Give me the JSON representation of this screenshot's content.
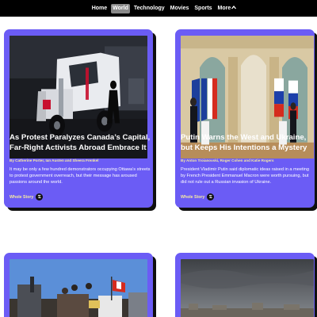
{
  "nav": {
    "items": [
      {
        "label": "Home",
        "active": false
      },
      {
        "label": "World",
        "active": true
      },
      {
        "label": "Technology",
        "active": false
      },
      {
        "label": "Movies",
        "active": false
      },
      {
        "label": "Sports",
        "active": false
      }
    ],
    "more_label": "More",
    "more_icon": "chevron-up-icon"
  },
  "colors": {
    "card_background": "#6b5cf5",
    "card_shadow": "#0f0f0f",
    "byline_color": "#f5e9a4",
    "nav_background": "#000000",
    "nav_active_background": "#8a8a8a"
  },
  "articles": [
    {
      "title": "As Protest Paralyzes Canada’s Capital, Far-Right Activists Abroad Embrace It",
      "byline": "By Catherine Porter, Ian Austen and Sheera Frenkel",
      "summary": "It may be only a few hundred demonstrators occupying Ottawa’s streets to protest government overreach, but their message has aroused passions around the world.",
      "link_label": "Whole Story",
      "link_icon": "nyt-logo-icon"
    },
    {
      "title": "Putin Warns the West and Ukraine, but Keeps His Intentions a Mystery",
      "byline": "By Anton Troianovski, Roger Cohen and Katie Rogers",
      "summary": "President Vladimir Putin said diplomatic ideas raised in a meeting by French President Emmanuel Macron were worth pursuing, but did not rule out a Russian invasion of Ukraine.",
      "link_label": "Whole Story",
      "link_icon": "nyt-logo-icon"
    }
  ]
}
